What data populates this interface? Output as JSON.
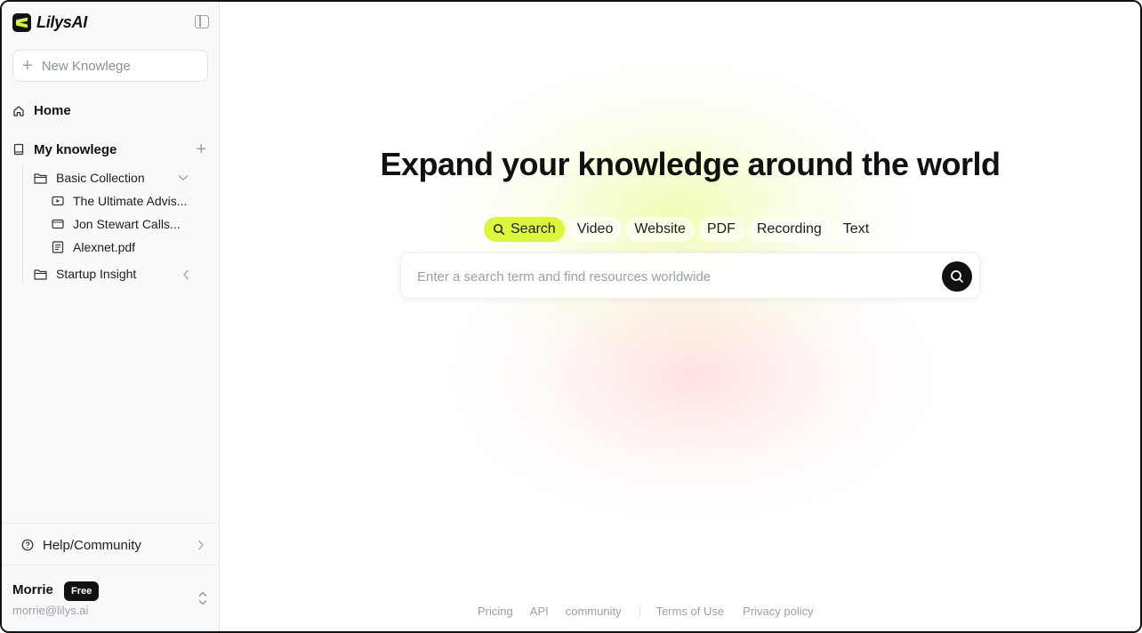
{
  "app": {
    "name": "LilysAI",
    "brand_color": "#111111",
    "accent_color": "#ddf53a"
  },
  "sidebar": {
    "new_knowledge_placeholder": "New Knowlege",
    "home_label": "Home",
    "my_knowledge_label": "My knowlege",
    "folders": [
      {
        "label": "Basic Collection",
        "expanded": true,
        "items": [
          {
            "label": "The Ultimate Advis...",
            "icon": "video-icon"
          },
          {
            "label": "Jon Stewart Calls...",
            "icon": "website-icon"
          },
          {
            "label": "Alexnet.pdf",
            "icon": "document-icon"
          }
        ]
      },
      {
        "label": "Startup Insight",
        "expanded": false,
        "items": []
      }
    ],
    "help_label": "Help/Community",
    "user": {
      "name": "Morrie",
      "plan": "Free",
      "email": "morrie@lilys.ai"
    }
  },
  "main": {
    "title": "Expand your knowledge around the world",
    "tabs": [
      {
        "label": "Search",
        "active": true
      },
      {
        "label": "Video",
        "active": false
      },
      {
        "label": "Website",
        "active": false
      },
      {
        "label": "PDF",
        "active": false
      },
      {
        "label": "Recording",
        "active": false
      },
      {
        "label": "Text",
        "active": false
      }
    ],
    "search_placeholder": "Enter a search term and find resources worldwide"
  },
  "footer": {
    "links_left": [
      "Pricing",
      "API",
      "community"
    ],
    "links_right": [
      "Terms of Use",
      "Privacy policy"
    ]
  }
}
